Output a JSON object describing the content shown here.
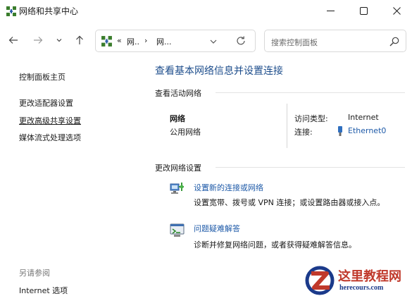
{
  "window": {
    "title": "网络和共享中心",
    "icons": {
      "app": "network-sharing-icon",
      "minimize": "minimize-icon",
      "maximize": "maximize-icon",
      "close": "close-icon"
    }
  },
  "nav": {
    "icons": [
      "arrow-left-icon",
      "arrow-right-icon",
      "chevron-down-icon",
      "arrow-up-icon"
    ],
    "address": {
      "icon": "network-sharing-icon",
      "more": "«",
      "crumbs": [
        "网..",
        "网..."
      ],
      "separator": "›",
      "refresh_icon": "refresh-icon"
    },
    "search": {
      "placeholder": "搜索控制面板",
      "icon": "search-icon"
    }
  },
  "sidebar": {
    "items": [
      {
        "label": "控制面板主页"
      },
      {
        "label": "更改适配器设置"
      },
      {
        "label": "更改高级共享设置",
        "underlined": true
      },
      {
        "label": "媒体流式处理选项"
      }
    ],
    "see_also": {
      "title": "另请参阅",
      "items": [
        {
          "label": "Internet 选项"
        }
      ]
    }
  },
  "main": {
    "heading": "查看基本网络信息并设置连接",
    "active_networks": {
      "label": "查看活动网络",
      "network": {
        "name": "网络",
        "type": "公用网络"
      },
      "access_type": {
        "label": "访问类型:",
        "value": "Internet"
      },
      "connections": {
        "label": "连接:",
        "value": "Ethernet0",
        "icon": "ethernet-icon"
      }
    },
    "change_settings": {
      "label": "更改网络设置",
      "tasks": [
        {
          "icon": "new-connection-icon",
          "title": "设置新的连接或网络",
          "description": "设置宽带、拨号或 VPN 连接；或设置路由器或接入点。"
        },
        {
          "icon": "troubleshoot-icon",
          "title": "问题疑难解答",
          "description": "诊断并修复网络问题，或者获得疑难解答信息。"
        }
      ]
    }
  },
  "watermark": {
    "title": "这里教程网",
    "url": "herecours.com"
  },
  "colors": {
    "link": "#1e5aa8",
    "heading": "#1e4e8c",
    "watermark_red": "#c0392b",
    "watermark_blue": "#1b3a8a"
  }
}
